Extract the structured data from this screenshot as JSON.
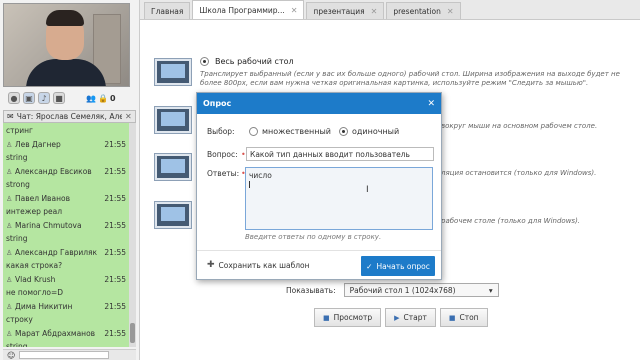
{
  "tabs": [
    {
      "label": "Главная"
    },
    {
      "label": "Школа Программир..."
    },
    {
      "label": "презентация"
    },
    {
      "label": "presentation"
    }
  ],
  "cam_toolbar": {
    "participants_count": "0"
  },
  "chat": {
    "title": "Чат: Ярослав Семеляк, Але...",
    "first_text": "стринг",
    "messages": [
      {
        "author": "Лев Дагнер",
        "time": "21:55",
        "text": "string"
      },
      {
        "author": "Александр Евсиков",
        "time": "21:55",
        "text": "strong"
      },
      {
        "author": "Павел Иванов",
        "time": "21:55",
        "text": "интежер реал"
      },
      {
        "author": "Marina Chmutova",
        "time": "21:55",
        "text": "string"
      },
      {
        "author": "Александр Гавриляк",
        "time": "21:55",
        "text": "какая строка?"
      },
      {
        "author": "Vlad Krush",
        "time": "21:55",
        "text": "не помогло=D"
      },
      {
        "author": "Дима Никитин",
        "time": "21:55",
        "text": "строку"
      },
      {
        "author": "Марат Абдрахманов",
        "time": "21:55",
        "text": "string"
      }
    ]
  },
  "main": {
    "options": [
      {
        "title": "Весь рабочий стол",
        "desc": "Транслирует выбранный (если у вас их больше одного) рабочий стол. Ширина изображения на выходе будет не более 800px, если вам нужна четкая оригинальная картинка, используйте режим \"Следить за мышью\"."
      },
      {
        "title": "",
        "desc": "вокруг мыши на основном рабочем столе."
      },
      {
        "title": "",
        "desc": "ляция остановится (только для Windows)."
      },
      {
        "title": "",
        "desc": "рабочем столе (только для Windows)."
      }
    ],
    "show_label": "Показывать:",
    "show_value": "Рабочий стол 1 (1024x768)",
    "preview_label": "Просмотр",
    "start_label": "Старт",
    "stop_label": "Стоп"
  },
  "dialog": {
    "title": "Опрос",
    "choice_label": "Выбор:",
    "choice_multi": "множественный",
    "choice_single": "одиночный",
    "question_label": "Вопрос:",
    "question_value": "Какой тип данных вводит пользователь",
    "answers_label": "Ответы:",
    "answers_value": "число",
    "hint": "Введите ответы по одному в строку.",
    "save_template": "Сохранить как шаблон",
    "start_poll": "Начать опрос"
  },
  "colors": {
    "accent": "#1d7bc9",
    "chat_bg": "#b5e6a1"
  }
}
